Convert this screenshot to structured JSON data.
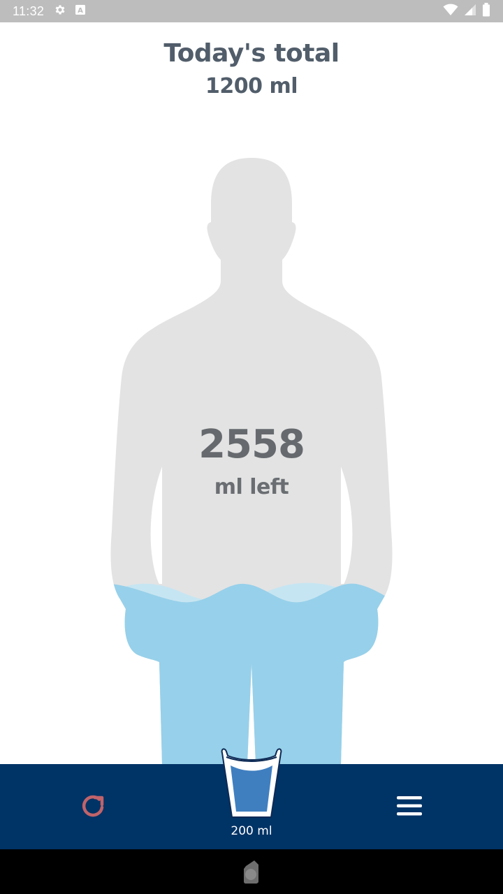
{
  "status_bar": {
    "time": "11:32",
    "icons": [
      "gear-icon",
      "a-notification-icon",
      "wifi-icon",
      "signal-icon",
      "battery-icon"
    ]
  },
  "header": {
    "title": "Today's total",
    "total": "1200 ml"
  },
  "progress": {
    "remaining_value": "2558",
    "remaining_unit_label": "ml left",
    "fill_fraction": 0.32
  },
  "bottom_bar": {
    "reset_icon": "refresh-icon",
    "cup_label": "200 ml",
    "cup_icon": "water-glass-icon",
    "menu_icon": "hamburger-menu-icon"
  },
  "colors": {
    "header_text": "#515d6a",
    "silhouette": "#e3e3e3",
    "water": "#97d0ea",
    "water_light": "#c6e5f2",
    "bottom_bar": "#003366",
    "reset_icon": "#c0636a",
    "cup_fill": "#3f7fc0"
  },
  "nav_bar": {
    "home_icon": "home-icon"
  }
}
